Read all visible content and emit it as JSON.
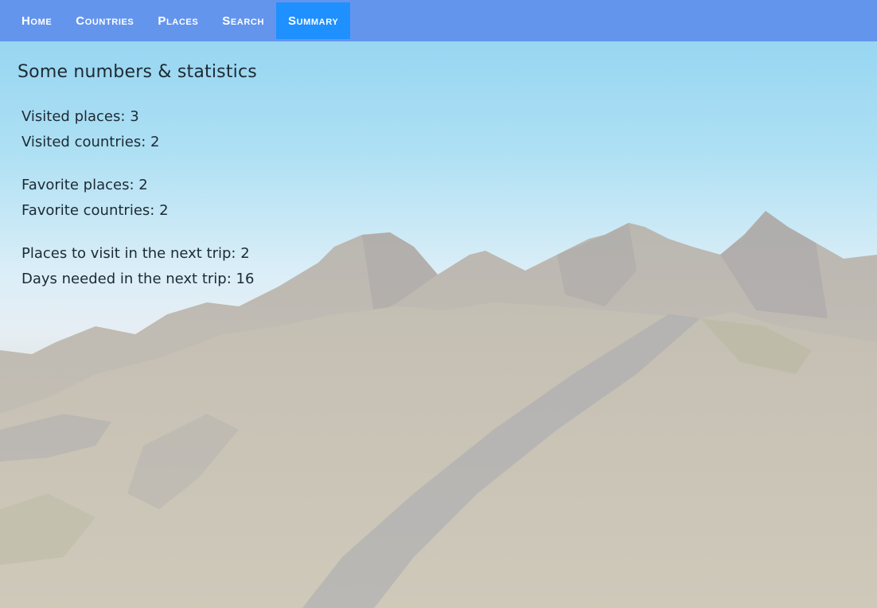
{
  "nav": {
    "items": [
      {
        "label": "Home"
      },
      {
        "label": "Countries"
      },
      {
        "label": "Places"
      },
      {
        "label": "Search"
      },
      {
        "label": "Summary"
      }
    ],
    "active": "Summary",
    "background_color": "#6495ed",
    "active_color": "#1e90ff"
  },
  "summary": {
    "title": "Some numbers & statistics",
    "groups": [
      {
        "lines": [
          {
            "label": "Visited places:",
            "value": "3"
          },
          {
            "label": "Visited countries:",
            "value": "2"
          }
        ]
      },
      {
        "lines": [
          {
            "label": "Favorite places:",
            "value": "2"
          },
          {
            "label": "Favorite countries:",
            "value": "2"
          }
        ]
      },
      {
        "lines": [
          {
            "label": "Places to visit in the next trip:",
            "value": "2"
          },
          {
            "label": "Days needed in the next trip:",
            "value": "16"
          }
        ]
      }
    ]
  },
  "background": {
    "icon": "mountain-landscape-image"
  }
}
